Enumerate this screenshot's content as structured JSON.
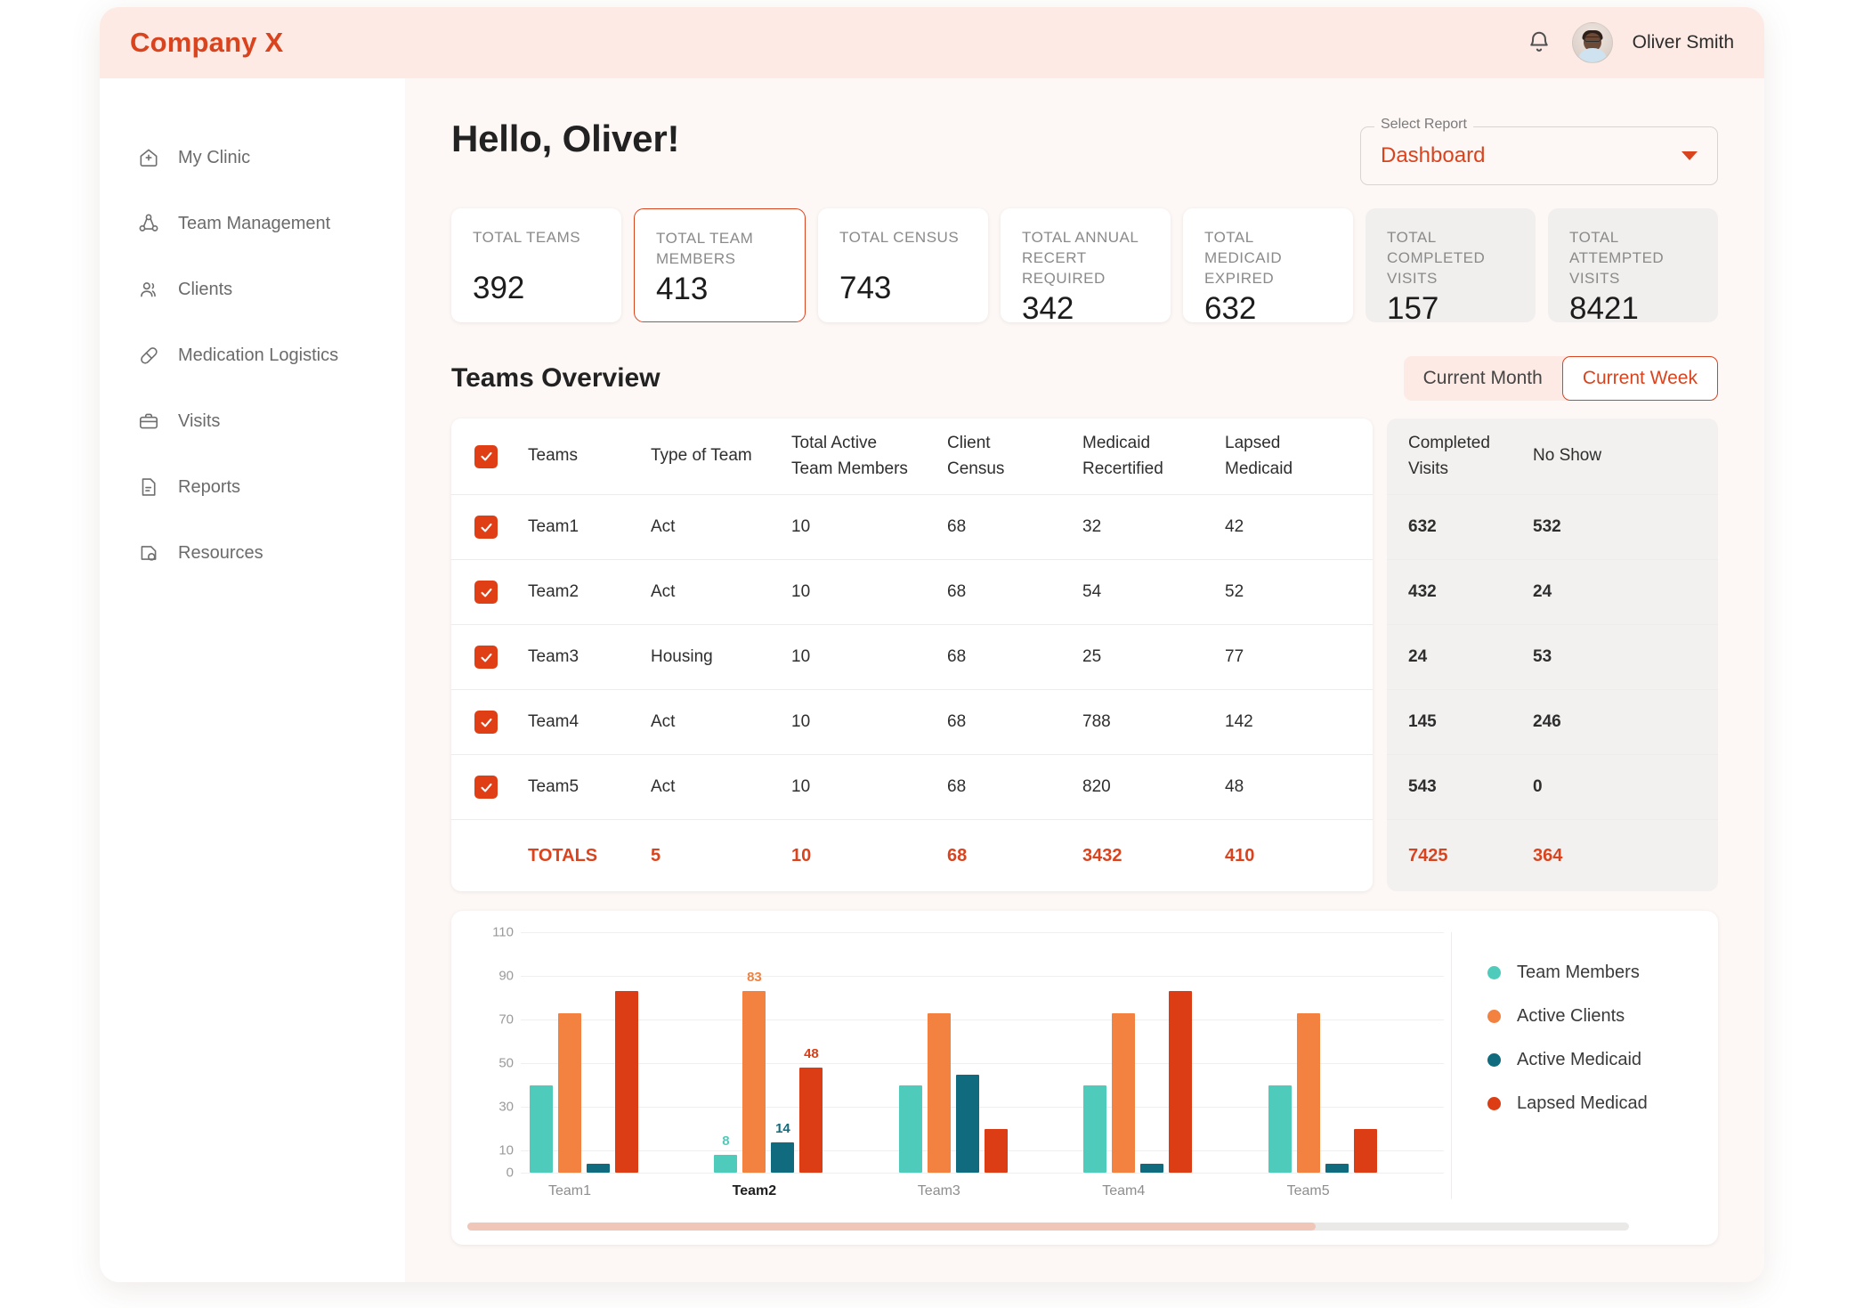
{
  "header": {
    "brand": "Company X",
    "bell_icon": "bell-icon",
    "user_name": "Oliver Smith"
  },
  "sidebar": {
    "items": [
      {
        "label": "My Clinic",
        "icon": "clinic-home-icon"
      },
      {
        "label": "Team Management",
        "icon": "team-network-icon"
      },
      {
        "label": "Clients",
        "icon": "users-icon"
      },
      {
        "label": "Medication Logistics",
        "icon": "pill-icon"
      },
      {
        "label": "Visits",
        "icon": "briefcase-icon"
      },
      {
        "label": "Reports",
        "icon": "document-icon"
      },
      {
        "label": "Resources",
        "icon": "pdf-file-icon"
      }
    ]
  },
  "main": {
    "greeting": "Hello, Oliver!",
    "select_report": {
      "label": "Select Report",
      "value": "Dashboard"
    },
    "kpis": [
      {
        "label": "TOTAL TEAMS",
        "value": "392",
        "style": "plain"
      },
      {
        "label": "TOTAL TEAM MEMBERS",
        "value": "413",
        "style": "selected"
      },
      {
        "label": "TOTAL CENSUS",
        "value": "743",
        "style": "plain"
      },
      {
        "label": "TOTAL ANNUAL RECERT REQUIRED",
        "value": "342",
        "style": "plain"
      },
      {
        "label": "TOTAL MEDICAID EXPIRED",
        "value": "632",
        "style": "plain"
      },
      {
        "label": "TOTAL COMPLETED VISITS",
        "value": "157",
        "style": "muted"
      },
      {
        "label": "TOTAL ATTEMPTED VISITS",
        "value": "8421",
        "style": "muted"
      }
    ],
    "section_title": "Teams Overview",
    "toggles": [
      {
        "label": "Current Month",
        "active": false
      },
      {
        "label": "Current Week",
        "active": true
      }
    ],
    "table": {
      "headers": {
        "teams": "Teams",
        "type": "Type of Team",
        "members_l1": "Total Active",
        "members_l2": "Team Members",
        "census_l1": "Client",
        "census_l2": "Census",
        "recert_l1": "Medicaid",
        "recert_l2": "Recertified",
        "lapsed_l1": "Lapsed",
        "lapsed_l2": "Medicaid",
        "completed_l1": "Completed",
        "completed_l2": "Visits",
        "noshow": "No Show"
      },
      "rows": [
        {
          "team": "Team1",
          "type": "Act",
          "members": "10",
          "census": "68",
          "recert": "32",
          "lapsed": "42",
          "completed": "632",
          "noshow": "532"
        },
        {
          "team": "Team2",
          "type": "Act",
          "members": "10",
          "census": "68",
          "recert": "54",
          "lapsed": "52",
          "completed": "432",
          "noshow": "24"
        },
        {
          "team": "Team3",
          "type": "Housing",
          "members": "10",
          "census": "68",
          "recert": "25",
          "lapsed": "77",
          "completed": "24",
          "noshow": "53"
        },
        {
          "team": "Team4",
          "type": "Act",
          "members": "10",
          "census": "68",
          "recert": "788",
          "lapsed": "142",
          "completed": "145",
          "noshow": "246"
        },
        {
          "team": "Team5",
          "type": "Act",
          "members": "10",
          "census": "68",
          "recert": "820",
          "lapsed": "48",
          "completed": "543",
          "noshow": "0"
        }
      ],
      "totals": {
        "label": "TOTALS",
        "team": "5",
        "type": "10",
        "members": "68",
        "census": "3432",
        "recert": "410",
        "completed": "7425",
        "noshow": "364"
      }
    }
  },
  "colors": {
    "brand": "#d9441f",
    "accent_orange": "#f3813f",
    "teal": "#4ecbbb",
    "dark_teal": "#0f6b7d",
    "red": "#dd3d14",
    "pink_bg": "#fdeae4",
    "scroll_thumb": "#f0c6b8"
  },
  "chart_data": {
    "type": "bar",
    "categories": [
      "Team1",
      "Team2",
      "Team3",
      "Team4",
      "Team5"
    ],
    "highlighted_category": "Team2",
    "series": [
      {
        "name": "Team Members",
        "color": "#4ecbbb",
        "values": [
          40,
          8,
          40,
          40,
          40
        ]
      },
      {
        "name": "Active Clients",
        "color": "#f3813f",
        "values": [
          73,
          83,
          73,
          73,
          73
        ]
      },
      {
        "name": "Active Medicaid",
        "color": "#0f6b7d",
        "values": [
          4,
          14,
          45,
          4,
          4
        ]
      },
      {
        "name": "Lapsed Medicad",
        "color": "#dd3d14",
        "values": [
          83,
          48,
          20,
          83,
          20
        ]
      }
    ],
    "labeled_group": "Team2",
    "labeled_values": [
      8,
      83,
      14,
      48
    ],
    "yticks": [
      0,
      10,
      30,
      50,
      70,
      90,
      110
    ],
    "ylim": [
      0,
      110
    ],
    "grid": true,
    "legend_position": "right",
    "title": "",
    "xlabel": "",
    "ylabel": "",
    "scroll_percent": 73
  }
}
